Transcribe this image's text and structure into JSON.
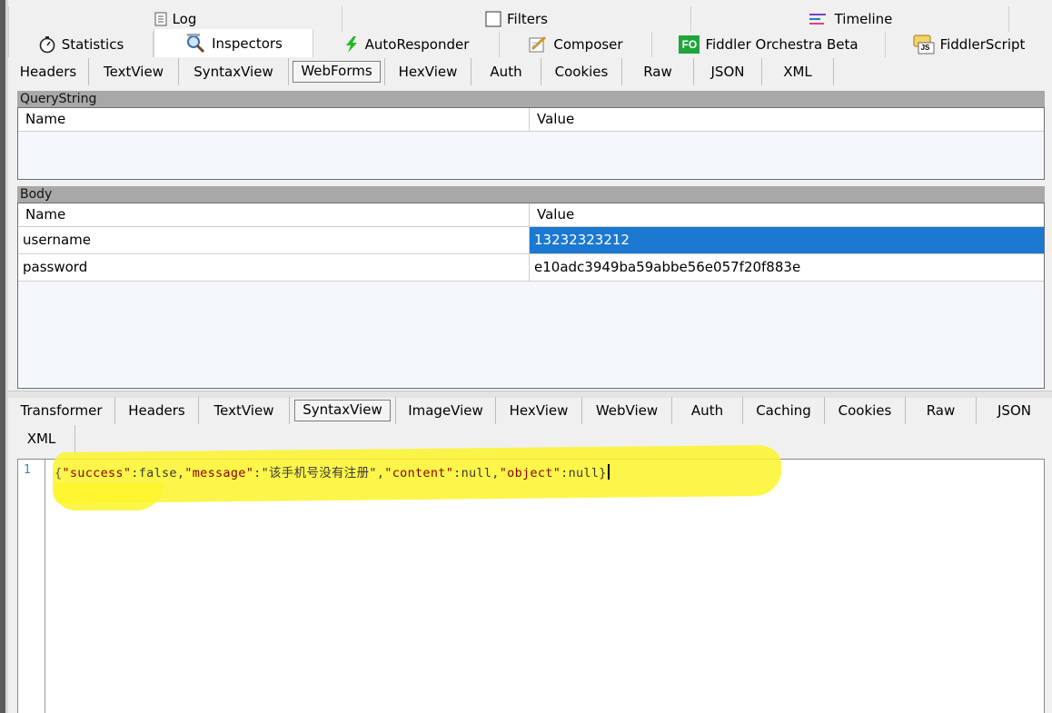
{
  "top_tabs_row1": [
    {
      "label": "Log",
      "icon": "log-icon"
    },
    {
      "label": "Filters",
      "icon": "filters-checkbox-icon"
    },
    {
      "label": "Timeline",
      "icon": "timeline-icon"
    }
  ],
  "top_tabs_row2": [
    {
      "label": "Statistics",
      "icon": "stopwatch-icon"
    },
    {
      "label": "Inspectors",
      "icon": "inspectors-magnifier-icon",
      "selected": true
    },
    {
      "label": "AutoResponder",
      "icon": "lightning-icon"
    },
    {
      "label": "Composer",
      "icon": "composer-pencil-icon"
    },
    {
      "label": "Fiddler Orchestra Beta",
      "icon": "fo-icon",
      "icon_text": "FO"
    },
    {
      "label": "FiddlerScript",
      "icon": "js-script-icon",
      "icon_text": "JS"
    }
  ],
  "request_tabs": [
    "Headers",
    "TextView",
    "SyntaxView",
    "WebForms",
    "HexView",
    "Auth",
    "Cookies",
    "Raw",
    "JSON",
    "XML"
  ],
  "request_tab_selected": "WebForms",
  "querystring": {
    "title": "QueryString",
    "col_name": "Name",
    "col_value": "Value"
  },
  "body": {
    "title": "Body",
    "col_name": "Name",
    "col_value": "Value",
    "rows": [
      {
        "name": "username",
        "value": "13232323212",
        "selected": true
      },
      {
        "name": "password",
        "value": "e10adc3949ba59abbe56e057f20f883e"
      }
    ]
  },
  "response_tabs_row1": [
    "Transformer",
    "Headers",
    "TextView",
    "SyntaxView",
    "ImageView",
    "HexView",
    "WebView",
    "Auth",
    "Caching",
    "Cookies",
    "Raw",
    "JSON"
  ],
  "response_tabs_row2": [
    "XML"
  ],
  "response_tab_selected": "SyntaxView",
  "editor": {
    "line_number": "1",
    "tokens": {
      "t0": "{",
      "t1": "\"success\"",
      "t2": ":false,",
      "t3": "\"message\"",
      "t4": ":\"该手机号没有注册\",",
      "t5": "\"content\"",
      "t6": ":null,",
      "t7": "\"object\"",
      "t8": ":null}"
    }
  },
  "colors": {
    "selection": "#1b79d1",
    "highlight_marker": "#fbf52a",
    "section_header": "#a8a8a8",
    "fo_icon": "#1fa53a",
    "lightning": "#25b825"
  }
}
